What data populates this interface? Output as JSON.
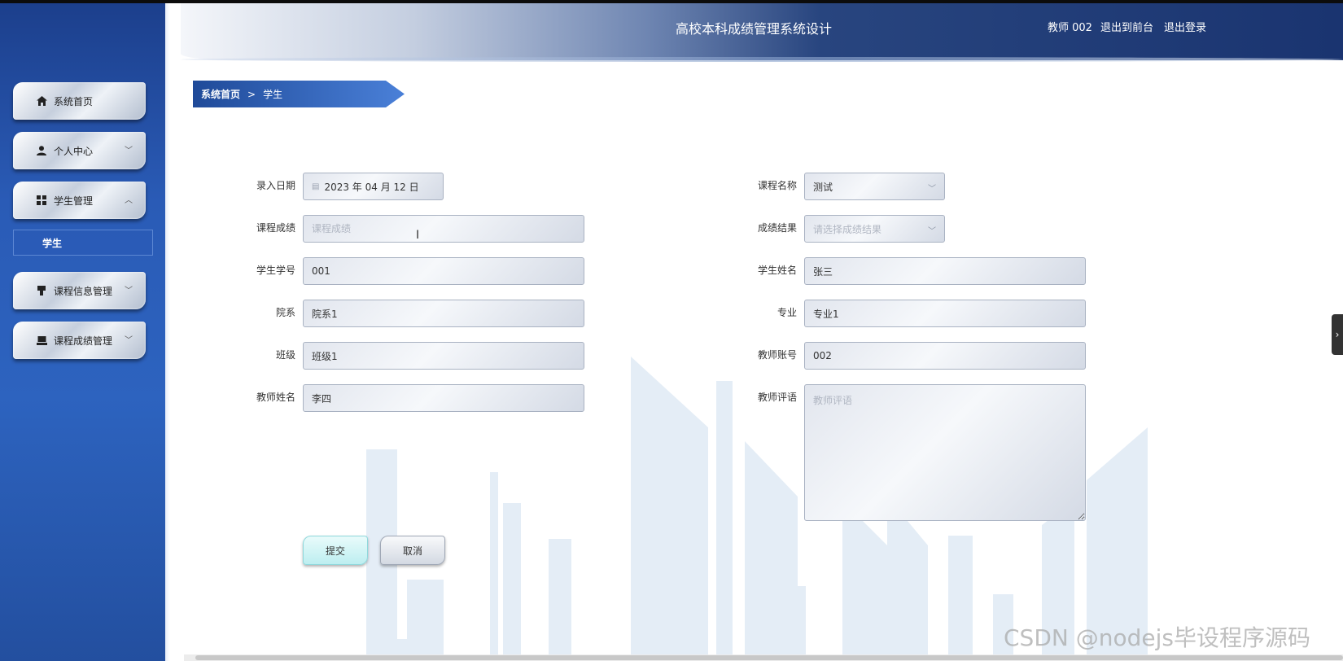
{
  "header": {
    "title": "高校本科成绩管理系统设计",
    "user": "教师 002",
    "links": [
      "退出到前台",
      "退出登录"
    ]
  },
  "sidebar": {
    "items": [
      {
        "label": "系统首页",
        "icon": "home-icon"
      },
      {
        "label": "个人中心",
        "icon": "user-icon",
        "expanded": false
      },
      {
        "label": "学生管理",
        "icon": "grid-icon",
        "expanded": true
      },
      {
        "label": "课程信息管理",
        "icon": "desk-icon",
        "expanded": false
      },
      {
        "label": "课程成绩管理",
        "icon": "laptop-icon",
        "expanded": false
      }
    ],
    "submenu": {
      "label": "学生"
    }
  },
  "breadcrumb": {
    "home": "系统首页",
    "separator": ">",
    "current": "学生"
  },
  "form": {
    "entry_date": {
      "label": "录入日期",
      "value": "2023 年 04 月 12 日"
    },
    "course_name": {
      "label": "课程名称",
      "value": "测试"
    },
    "course_score": {
      "label": "课程成绩",
      "placeholder": "课程成绩"
    },
    "score_result": {
      "label": "成绩结果",
      "placeholder": "请选择成绩结果"
    },
    "student_id": {
      "label": "学生学号",
      "value": "001"
    },
    "student_name": {
      "label": "学生姓名",
      "value": "张三"
    },
    "department": {
      "label": "院系",
      "value": "院系1"
    },
    "major": {
      "label": "专业",
      "value": "专业1"
    },
    "class": {
      "label": "班级",
      "value": "班级1"
    },
    "teacher_account": {
      "label": "教师账号",
      "value": "002"
    },
    "teacher_name": {
      "label": "教师姓名",
      "value": "李四"
    },
    "teacher_comment": {
      "label": "教师评语",
      "placeholder": "教师评语"
    }
  },
  "buttons": {
    "submit": "提交",
    "cancel": "取消"
  },
  "side_tab": {
    "label": "›"
  },
  "watermark": "CSDN @nodejs毕设程序源码"
}
